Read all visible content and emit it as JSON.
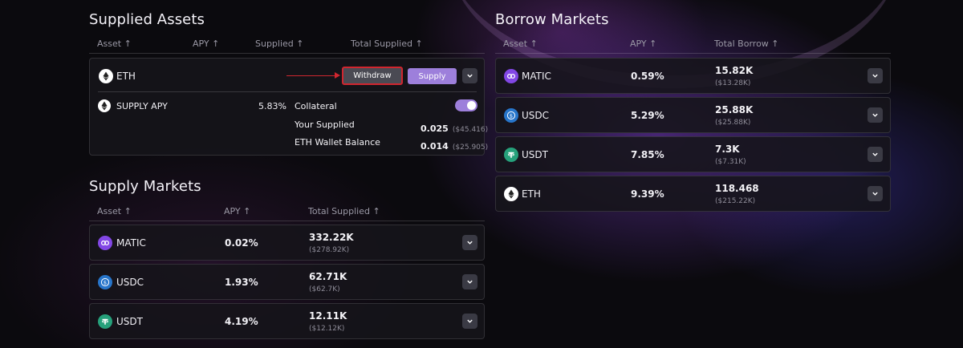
{
  "supplied_assets": {
    "title": "Supplied Assets",
    "columns": [
      "Asset ↑",
      "APY ↑",
      "Supplied ↑",
      "Total Supplied ↑"
    ],
    "item": {
      "asset": "ETH",
      "withdraw_label": "Withdraw",
      "supply_label": "Supply",
      "supply_apy_label": "SUPPLY APY",
      "supply_apy_value": "5.83%",
      "collateral_label": "Collateral",
      "collateral_enabled": true,
      "your_supplied_label": "Your Supplied",
      "your_supplied_value": "0.025",
      "your_supplied_usd": "($45.416)",
      "wallet_balance_label": "ETH Wallet Balance",
      "wallet_balance_value": "0.014",
      "wallet_balance_usd": "($25.905)"
    }
  },
  "supply_markets": {
    "title": "Supply Markets",
    "columns": [
      "Asset ↑",
      "APY ↑",
      "Total Supplied ↑"
    ],
    "rows": [
      {
        "asset": "MATIC",
        "icon": "matic-icon",
        "apy": "0.02%",
        "total": "332.22K",
        "usd": "($278.92K)"
      },
      {
        "asset": "USDC",
        "icon": "usdc-icon",
        "apy": "1.93%",
        "total": "62.71K",
        "usd": "($62.7K)"
      },
      {
        "asset": "USDT",
        "icon": "usdt-icon",
        "apy": "4.19%",
        "total": "12.11K",
        "usd": "($12.12K)"
      }
    ]
  },
  "borrow_markets": {
    "title": "Borrow Markets",
    "columns": [
      "Asset ↑",
      "APY ↑",
      "Total Borrow ↑"
    ],
    "rows": [
      {
        "asset": "MATIC",
        "icon": "matic-icon",
        "apy": "0.59%",
        "total": "15.82K",
        "usd": "($13.28K)"
      },
      {
        "asset": "USDC",
        "icon": "usdc-icon",
        "apy": "5.29%",
        "total": "25.88K",
        "usd": "($25.88K)"
      },
      {
        "asset": "USDT",
        "icon": "usdt-icon",
        "apy": "7.85%",
        "total": "7.3K",
        "usd": "($7.31K)"
      },
      {
        "asset": "ETH",
        "icon": "eth-icon",
        "apy": "9.39%",
        "total": "118.468",
        "usd": "($215.22K)"
      }
    ]
  },
  "colors": {
    "accent": "#9d7fdb",
    "highlight": "#d1262f",
    "matic": "#8247e5",
    "usdc": "#2775ca",
    "usdt": "#26a17b"
  }
}
